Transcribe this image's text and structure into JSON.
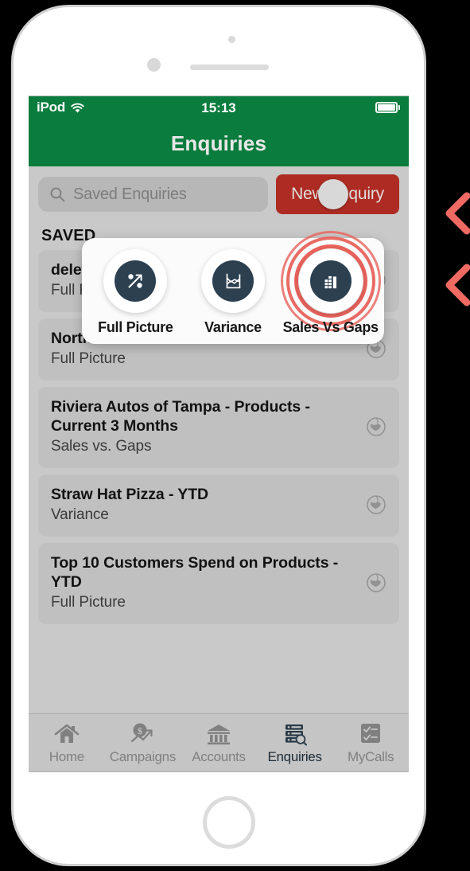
{
  "device": {
    "status_bar": {
      "carrier": "iPod",
      "wifi_icon": "wifi-icon",
      "time": "15:13",
      "battery_icon": "battery-full-icon"
    }
  },
  "nav": {
    "title": "Enquiries"
  },
  "search": {
    "placeholder": "Saved Enquiries",
    "value": "",
    "icon": "search-icon"
  },
  "toolbar": {
    "new_enquiry_label": "New Enquiry",
    "new_enquiry_color": "#ad2b22",
    "cursor_indicator": "touch-cursor"
  },
  "section": {
    "header": "SAVED"
  },
  "popup": {
    "items": [
      {
        "label": "Full Picture",
        "icon": "percent-trend-icon",
        "highlighted": false
      },
      {
        "label": "Variance",
        "icon": "line-chart-icon",
        "highlighted": false
      },
      {
        "label": "Sales Vs Gaps",
        "icon": "bar-chart-icon",
        "highlighted": true
      }
    ],
    "highlight_color": "#e8635c"
  },
  "list": {
    "items": [
      {
        "title": "delete",
        "subtitle": "Full Picture",
        "icon": "globe-icon"
      },
      {
        "title": "Northwest Auto Service - Products - YTD",
        "subtitle": "Full Picture",
        "icon": "globe-icon"
      },
      {
        "title": "Riviera Autos of Tampa - Products - Current 3 Months",
        "subtitle": "Sales vs. Gaps",
        "icon": "globe-icon"
      },
      {
        "title": "Straw Hat Pizza - YTD",
        "subtitle": "Variance",
        "icon": "globe-icon"
      },
      {
        "title": "Top 10 Customers Spend on Products - YTD",
        "subtitle": "Full Picture",
        "icon": "globe-icon"
      }
    ]
  },
  "tabs": [
    {
      "label": "Home",
      "icon": "home-icon",
      "active": false
    },
    {
      "label": "Campaigns",
      "icon": "dollar-trend-icon",
      "active": false
    },
    {
      "label": "Accounts",
      "icon": "bank-icon",
      "active": false
    },
    {
      "label": "Enquiries",
      "icon": "list-search-icon",
      "active": true
    },
    {
      "label": "MyCalls",
      "icon": "checklist-icon",
      "active": false
    }
  ],
  "annotations": {
    "markers": [
      {
        "name": "chevron-marker-1",
        "glyph": "<"
      },
      {
        "name": "chevron-marker-2",
        "glyph": "<"
      }
    ],
    "color": "#ef6a63"
  },
  "theme": {
    "header_green": "#0a7c3d",
    "accent_red": "#ad2b22",
    "icon_navy": "#2c4050"
  }
}
